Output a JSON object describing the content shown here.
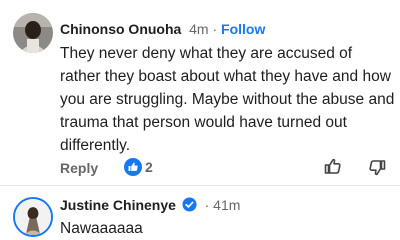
{
  "comments": [
    {
      "author": "Chinonso Onuoha",
      "time": "4m",
      "separator": "·",
      "follow_label": "Follow",
      "text": "They never deny what they are accused of rather they boast about what they have and how you are struggling. Maybe without the abuse and trauma that person would have turned out differently.",
      "reply_label": "Reply",
      "reaction_count": "2",
      "accent": "#1877f2"
    },
    {
      "author": "Justine Chinenye",
      "time": "41m",
      "verified": true,
      "text": "Nawaaaaaa"
    }
  ],
  "icons": [
    "thumbs-up-icon",
    "thumbs-down-icon",
    "verified-badge-icon",
    "like-reaction-icon"
  ]
}
